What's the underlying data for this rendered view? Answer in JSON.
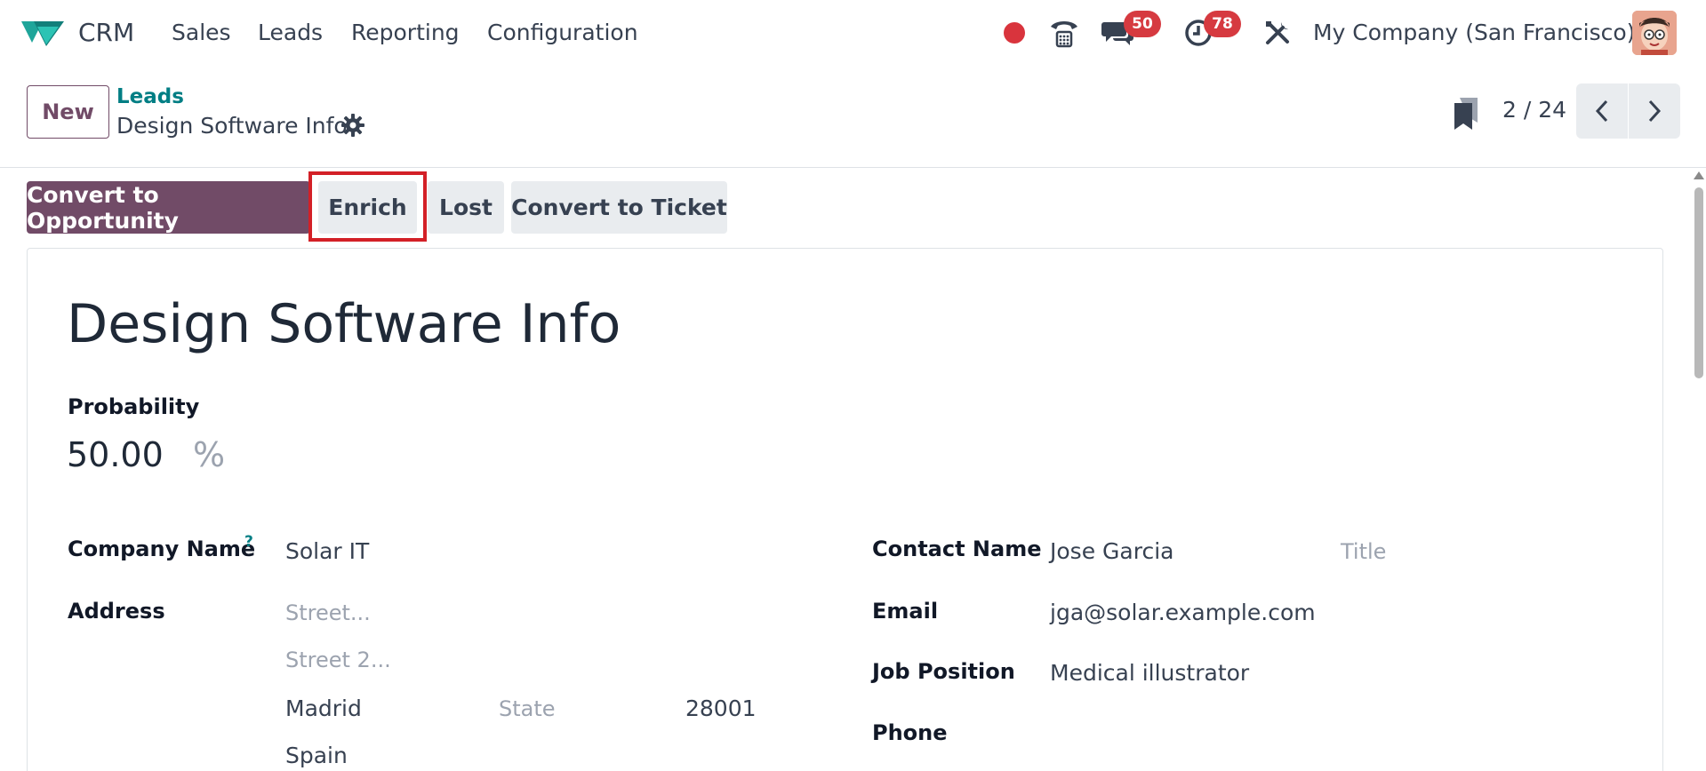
{
  "nav": {
    "app_name": "CRM",
    "menu": [
      "Sales",
      "Leads",
      "Reporting",
      "Configuration"
    ],
    "messages_count": "50",
    "activities_count": "78",
    "company": "My Company (San Francisco)"
  },
  "control_panel": {
    "new_label": "New",
    "breadcrumb_parent": "Leads",
    "breadcrumb_current": "Design Software Info",
    "pager": "2 / 24"
  },
  "statusbar": {
    "convert_opportunity": "Convert to Opportunity",
    "enrich": "Enrich",
    "lost": "Lost",
    "convert_ticket": "Convert to Ticket"
  },
  "form": {
    "title": "Design Software Info",
    "probability_label": "Probability",
    "probability_value": "50.00",
    "probability_unit": "%",
    "company_name_label": "Company Name",
    "company_help": "?",
    "company_name": "Solar IT",
    "address_label": "Address",
    "street_placeholder": "Street...",
    "street2_placeholder": "Street 2...",
    "city": "Madrid",
    "state_placeholder": "State",
    "zip": "28001",
    "country": "Spain",
    "contact_name_label": "Contact Name",
    "contact_name": "Jose Garcia",
    "title_placeholder": "Title",
    "email_label": "Email",
    "email": "jga@solar.example.com",
    "job_position_label": "Job Position",
    "job_position": "Medical illustrator",
    "phone_label": "Phone"
  },
  "colors": {
    "brand": "#714b67",
    "link": "#017e84",
    "badge": "#d63a40",
    "highlight": "#d32027"
  }
}
